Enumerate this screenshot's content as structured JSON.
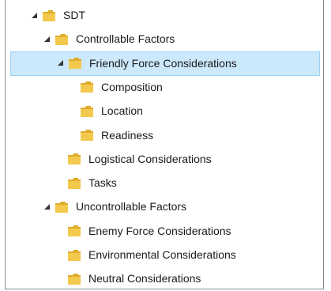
{
  "tree": {
    "nodes": [
      {
        "label": "SDT",
        "level": 0,
        "expanded": true,
        "has_children": true,
        "selected": false
      },
      {
        "label": "Controllable Factors",
        "level": 1,
        "expanded": true,
        "has_children": true,
        "selected": false
      },
      {
        "label": "Friendly Force Considerations",
        "level": 2,
        "expanded": true,
        "has_children": true,
        "selected": true
      },
      {
        "label": "Composition",
        "level": 3,
        "expanded": false,
        "has_children": false,
        "selected": false
      },
      {
        "label": "Location",
        "level": 3,
        "expanded": false,
        "has_children": false,
        "selected": false
      },
      {
        "label": "Readiness",
        "level": 3,
        "expanded": false,
        "has_children": false,
        "selected": false
      },
      {
        "label": "Logistical Considerations",
        "level": 2,
        "expanded": false,
        "has_children": false,
        "selected": false
      },
      {
        "label": "Tasks",
        "level": 2,
        "expanded": false,
        "has_children": false,
        "selected": false
      },
      {
        "label": "Uncontrollable Factors",
        "level": 1,
        "expanded": true,
        "has_children": true,
        "selected": false
      },
      {
        "label": "Enemy Force Considerations",
        "level": 2,
        "expanded": false,
        "has_children": false,
        "selected": false
      },
      {
        "label": "Environmental Considerations",
        "level": 2,
        "expanded": false,
        "has_children": false,
        "selected": false
      },
      {
        "label": "Neutral Considerations",
        "level": 2,
        "expanded": false,
        "has_children": false,
        "selected": false
      }
    ]
  },
  "colors": {
    "selection_bg": "#cce8fb",
    "selection_border": "#99d1f7",
    "folder_body": "#f2c94c",
    "folder_tab": "#e0ac2b"
  },
  "icons": {
    "expand": "expand-arrow-icon",
    "folder": "folder-icon"
  }
}
